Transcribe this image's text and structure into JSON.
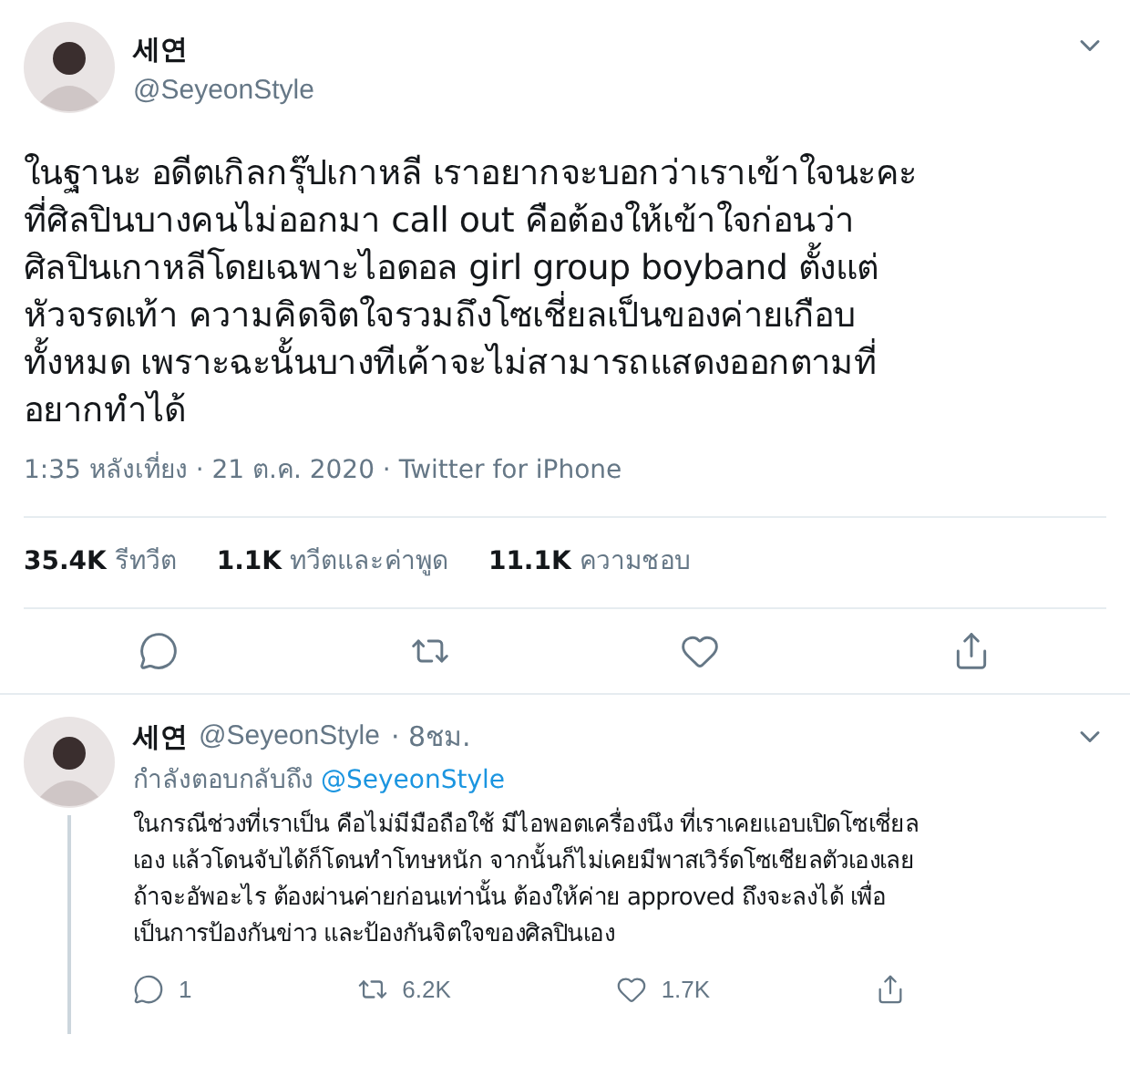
{
  "tweet": {
    "name": "세연",
    "handle": "@SeyeonStyle",
    "text": "ในฐานะ อดีตเกิลกรุ๊ปเกาหลี เราอยากจะบอกว่าเราเข้าใจนะคะ\nที่ศิลปินบางคนไม่ออกมา call out คือต้องให้เข้าใจก่อนว่า\nศิลปินเกาหลีโดยเฉพาะไอดอล girl group boyband ตั้งแต่\nหัวจรดเท้า ความคิดจิตใจรวมถึงโซเชี่ยลเป็นของค่ายเกือบ\nทั้งหมด เพราะฉะนั้นบางทีเค้าจะไม่สามารถแสดงออกตามที่\nอยากทำได้",
    "meta": "1:35 หลังเที่ยง · 21 ต.ค. 2020 · Twitter for iPhone",
    "stats": [
      {
        "count": "35.4K",
        "label": "รีทวีต"
      },
      {
        "count": "1.1K",
        "label": "ทวีตและค่าพูด"
      },
      {
        "count": "11.1K",
        "label": "ความชอบ"
      }
    ],
    "actions": [
      {
        "kind": "reply"
      },
      {
        "kind": "retweet"
      },
      {
        "kind": "like"
      },
      {
        "kind": "share"
      }
    ]
  },
  "reply": {
    "name": "세연",
    "handle": "@SeyeonStyle",
    "time": "· 8ชม.",
    "replying_to": "กำลังตอบกลับถึง",
    "mention": "@SeyeonStyle",
    "text": "ในกรณีช่วงที่เราเป็น คือไม่มีมือถือใช้ มีไอพอตเครื่องนึง ที่เราเคยแอบเปิดโซเชี่ยล\nเอง แล้วโดนจับได้ก็โดนทำโทษหนัก จากนั้นก็ไม่เคยมีพาสเวิร์ดโซเชียลตัวเองเลย\nถ้าจะอัพอะไร ต้องผ่านค่ายก่อนเท่านั้น ต้องให้ค่าย approved ถึงจะลงได้ เพื่อ\nเป็นการป้องกันข่าว และป้องกันจิตใจของศิลปินเอง",
    "actions": [
      {
        "kind": "reply",
        "count": "1"
      },
      {
        "kind": "retweet",
        "count": "6.2K"
      },
      {
        "kind": "like",
        "count": "1.7K"
      },
      {
        "kind": "share"
      }
    ]
  }
}
